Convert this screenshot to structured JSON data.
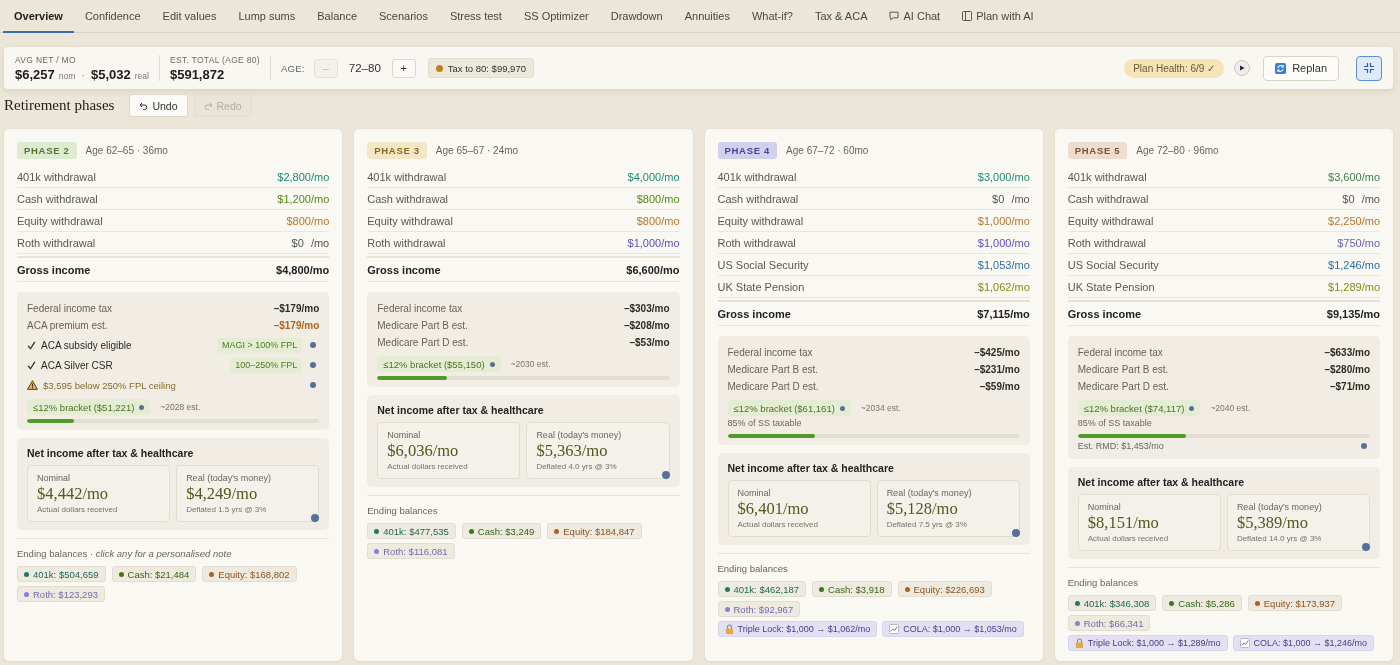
{
  "tabs": [
    {
      "label": "Overview",
      "selected": true,
      "kind": "plain"
    },
    {
      "label": "Confidence",
      "selected": false,
      "kind": "plain"
    },
    {
      "label": "Edit values",
      "selected": false,
      "kind": "plain"
    },
    {
      "label": "Lump sums",
      "selected": false,
      "kind": "plain"
    },
    {
      "label": "Balance",
      "selected": false,
      "kind": "plain"
    },
    {
      "label": "Scenarios",
      "selected": false,
      "kind": "plain"
    },
    {
      "label": "Stress test",
      "selected": false,
      "kind": "plain"
    },
    {
      "label": "SS Optimizer",
      "selected": false,
      "kind": "plain"
    },
    {
      "label": "Drawdown",
      "selected": false,
      "kind": "plain"
    },
    {
      "label": "Annuities",
      "selected": false,
      "kind": "plain"
    },
    {
      "label": "What-if?",
      "selected": false,
      "kind": "plain"
    },
    {
      "label": "Tax & ACA",
      "selected": false,
      "kind": "plain"
    },
    {
      "label": "AI Chat",
      "selected": false,
      "kind": "chat"
    },
    {
      "label": "Plan with AI",
      "selected": false,
      "kind": "plan"
    }
  ],
  "summary": {
    "avg_net": {
      "label": "AVG NET / MO",
      "nominal": "$6,257",
      "nominal_unit": "nom",
      "separator": "·",
      "real": "$5,032",
      "real_unit": "real"
    },
    "est_total": {
      "label": "EST. TOTAL (AGE 80)",
      "value": "$591,872"
    },
    "age": {
      "label": "AGE:",
      "range": "72–80",
      "minus": {
        "label": "–",
        "disabled": true
      },
      "plus": {
        "label": "+",
        "disabled": false
      }
    },
    "tax_tag": {
      "label": "Tax to 80: $99,970",
      "color": "#c47f1c"
    },
    "plan_health": "Plan Health: 6/9 ✓",
    "replan": "Replan",
    "collapse": {
      "on": true
    }
  },
  "section": {
    "title": "Retirement phases",
    "undo": {
      "label": "Undo",
      "disabled": false
    },
    "redo": {
      "label": "Redo",
      "disabled": true
    }
  },
  "phases": [
    {
      "badge": {
        "label": "PHASE 2",
        "color": "#547431"
      },
      "meta": "Age 62–65 · 36mo",
      "income": [
        {
          "label": "401k withdrawal",
          "value": "$2,800/mo",
          "color": "#1e8a72"
        },
        {
          "label": "Cash withdrawal",
          "value": "$1,200/mo",
          "color": "#55871a"
        },
        {
          "label": "Equity withdrawal",
          "value": "$800/mo",
          "color": "#b6762c"
        },
        {
          "label": "Roth withdrawal",
          "value": "$0 /mo",
          "color": "#555555"
        }
      ],
      "gross": {
        "label": "Gross income",
        "value": "$4,800/mo"
      },
      "tax": {
        "lines": [
          {
            "label": "Federal income tax",
            "value": "–$179/mo",
            "color": "#2e2c28"
          },
          {
            "label": "ACA premium est.",
            "value": "–$179/mo",
            "color": "#b0651e"
          }
        ],
        "statuses": [
          {
            "kind": "check",
            "label": "ACA subsidy eligible",
            "tag": "MAGI > 100% FPL"
          },
          {
            "kind": "check",
            "label": "ACA Silver CSR",
            "tag": "100–250% FPL"
          },
          {
            "kind": "warning",
            "label": "$3,595 below 250% FPL ceiling"
          }
        ],
        "bracket": {
          "label": "≤12% bracket ($51,221)",
          "year": "~2028 est.",
          "level": 0.16
        }
      },
      "net": {
        "title": "Net income after tax & healthcare",
        "nominal": {
          "label": "Nominal",
          "value": "$4,442/mo",
          "sub": "Actual dollars received"
        },
        "real": {
          "label": "Real (today's money)",
          "value": "$4,249/mo",
          "sub": "Deflated 1.5 yrs @ 3%"
        }
      },
      "balances": {
        "title": "Ending balances · *click any for a personalised note*",
        "chips": [
          {
            "label": "401k: $504,659",
            "color": "#1f7a66"
          },
          {
            "label": "Cash: $21,484",
            "color": "#3c7a12"
          },
          {
            "label": "Equity: $168,802",
            "color": "#b0601c"
          },
          {
            "label": "Roth: $123,293",
            "color": "#8a7fd8"
          }
        ]
      }
    },
    {
      "badge": {
        "label": "PHASE 3",
        "color": "#8a6a1c"
      },
      "meta": "Age 65–67 · 24mo",
      "income": [
        {
          "label": "401k withdrawal",
          "value": "$4,000/mo",
          "color": "#1e8a72"
        },
        {
          "label": "Cash withdrawal",
          "value": "$800/mo",
          "color": "#55871a"
        },
        {
          "label": "Equity withdrawal",
          "value": "$800/mo",
          "color": "#b6762c"
        },
        {
          "label": "Roth withdrawal",
          "value": "$1,000/mo",
          "color": "#5a4fc4"
        }
      ],
      "gross": {
        "label": "Gross income",
        "value": "$6,600/mo"
      },
      "tax": {
        "lines": [
          {
            "label": "Federal income tax",
            "value": "–$303/mo",
            "color": "#2e2c28"
          },
          {
            "label": "Medicare Part B est.",
            "value": "–$208/mo",
            "color": "#2e2c28"
          },
          {
            "label": "Medicare Part D est.",
            "value": "–$53/mo",
            "color": "#2e2c28"
          }
        ],
        "bracket": {
          "label": "≤12% bracket ($55,150)",
          "year": "~2030 est.",
          "level": 0.24
        }
      },
      "net": {
        "title": "Net income after tax & healthcare",
        "nominal": {
          "label": "Nominal",
          "value": "$6,036/mo",
          "sub": "Actual dollars received"
        },
        "real": {
          "label": "Real (today's money)",
          "value": "$5,363/mo",
          "sub": "Deflated 4.0 yrs @ 3%"
        }
      },
      "balances": {
        "title": "Ending balances",
        "chips": [
          {
            "label": "401k: $477,535",
            "color": "#1f7a66"
          },
          {
            "label": "Cash: $3,249",
            "color": "#3c7a12"
          },
          {
            "label": "Equity: $184,847",
            "color": "#b0601c"
          },
          {
            "label": "Roth: $116,081",
            "color": "#8a7fd8"
          }
        ]
      }
    },
    {
      "badge": {
        "label": "PHASE 4",
        "color": "#46449a"
      },
      "meta": "Age 67–72 · 60mo",
      "income": [
        {
          "label": "401k withdrawal",
          "value": "$3,000/mo",
          "color": "#1e8a72"
        },
        {
          "label": "Cash withdrawal",
          "value": "$0 /mo",
          "color": "#555555"
        },
        {
          "label": "Equity withdrawal",
          "value": "$1,000/mo",
          "color": "#b6762c"
        },
        {
          "label": "Roth withdrawal",
          "value": "$1,000/mo",
          "color": "#5a4fc4"
        },
        {
          "label": "US Social Security",
          "value": "$1,053/mo",
          "color": "#2d6ea3"
        },
        {
          "label": "UK State Pension",
          "value": "$1,062/mo",
          "color": "#8a8a18"
        }
      ],
      "gross": {
        "label": "Gross income",
        "value": "$7,115/mo"
      },
      "tax": {
        "lines": [
          {
            "label": "Federal income tax",
            "value": "–$425/mo",
            "color": "#2e2c28"
          },
          {
            "label": "Medicare Part B est.",
            "value": "–$231/mo",
            "color": "#2e2c28"
          },
          {
            "label": "Medicare Part D est.",
            "value": "–$59/mo",
            "color": "#2e2c28"
          }
        ],
        "bracket": {
          "label": "≤12% bracket ($61,161)",
          "year": "~2034 est.",
          "note": "85% of SS taxable",
          "level": 0.3
        }
      },
      "net": {
        "title": "Net income after tax & healthcare",
        "nominal": {
          "label": "Nominal",
          "value": "$6,401/mo",
          "sub": "Actual dollars received"
        },
        "real": {
          "label": "Real (today's money)",
          "value": "$5,128/mo",
          "sub": "Deflated 7.5 yrs @ 3%"
        }
      },
      "balances": {
        "title": "Ending balances",
        "chips": [
          {
            "label": "401k: $462,187",
            "color": "#1f7a66"
          },
          {
            "label": "Cash: $3,918",
            "color": "#3c7a12"
          },
          {
            "label": "Equity: $226,693",
            "color": "#b0601c"
          },
          {
            "label": "Roth: $92,967",
            "color": "#8a7fd8"
          }
        ],
        "extras": [
          {
            "kind": "triple_lock",
            "label": "Triple Lock: $1,000 → $1,062/mo"
          },
          {
            "kind": "cola",
            "label": "COLA: $1,000 → $1,053/mo"
          }
        ]
      }
    },
    {
      "badge": {
        "label": "PHASE 5",
        "color": "#7a5430"
      },
      "meta": "Age 72–80 · 96mo",
      "income": [
        {
          "label": "401k withdrawal",
          "value": "$3,600/mo",
          "color": "#3f7f4f"
        },
        {
          "label": "Cash withdrawal",
          "value": "$0 /mo",
          "color": "#555555"
        },
        {
          "label": "Equity withdrawal",
          "value": "$2,250/mo",
          "color": "#b6762c"
        },
        {
          "label": "Roth withdrawal",
          "value": "$750/mo",
          "color": "#6a62b8"
        },
        {
          "label": "US Social Security",
          "value": "$1,246/mo",
          "color": "#2d6ea3"
        },
        {
          "label": "UK State Pension",
          "value": "$1,289/mo",
          "color": "#8a8a18"
        }
      ],
      "gross": {
        "label": "Gross income",
        "value": "$9,135/mo"
      },
      "tax": {
        "lines": [
          {
            "label": "Federal income tax",
            "value": "–$633/mo",
            "color": "#2e2c28"
          },
          {
            "label": "Medicare Part B est.",
            "value": "–$280/mo",
            "color": "#2e2c28"
          },
          {
            "label": "Medicare Part D est.",
            "value": "–$71/mo",
            "color": "#2e2c28"
          }
        ],
        "bracket": {
          "label": "≤12% bracket ($74,117)",
          "year": "~2040 est.",
          "note": "85% of SS taxable",
          "level": 0.37,
          "rmd": "Est. RMD: $1,453/mo"
        }
      },
      "net": {
        "title": "Net income after tax & healthcare",
        "nominal": {
          "label": "Nominal",
          "value": "$8,151/mo",
          "sub": "Actual dollars received"
        },
        "real": {
          "label": "Real (today's money)",
          "value": "$5,389/mo",
          "sub": "Deflated 14.0 yrs @ 3%"
        }
      },
      "balances": {
        "title": "Ending balances",
        "chips": [
          {
            "label": "401k: $346,308",
            "color": "#1f7a66"
          },
          {
            "label": "Cash: $5,286",
            "color": "#3c7a12"
          },
          {
            "label": "Equity: $173,937",
            "color": "#b0601c"
          },
          {
            "label": "Roth: $66,341",
            "color": "#8a7fd8"
          }
        ],
        "extras": [
          {
            "kind": "triple_lock",
            "label": "Triple Lock: $1,000 → $1,289/mo"
          },
          {
            "kind": "cola",
            "label": "COLA: $1,000 → $1,246/mo"
          }
        ]
      }
    }
  ]
}
